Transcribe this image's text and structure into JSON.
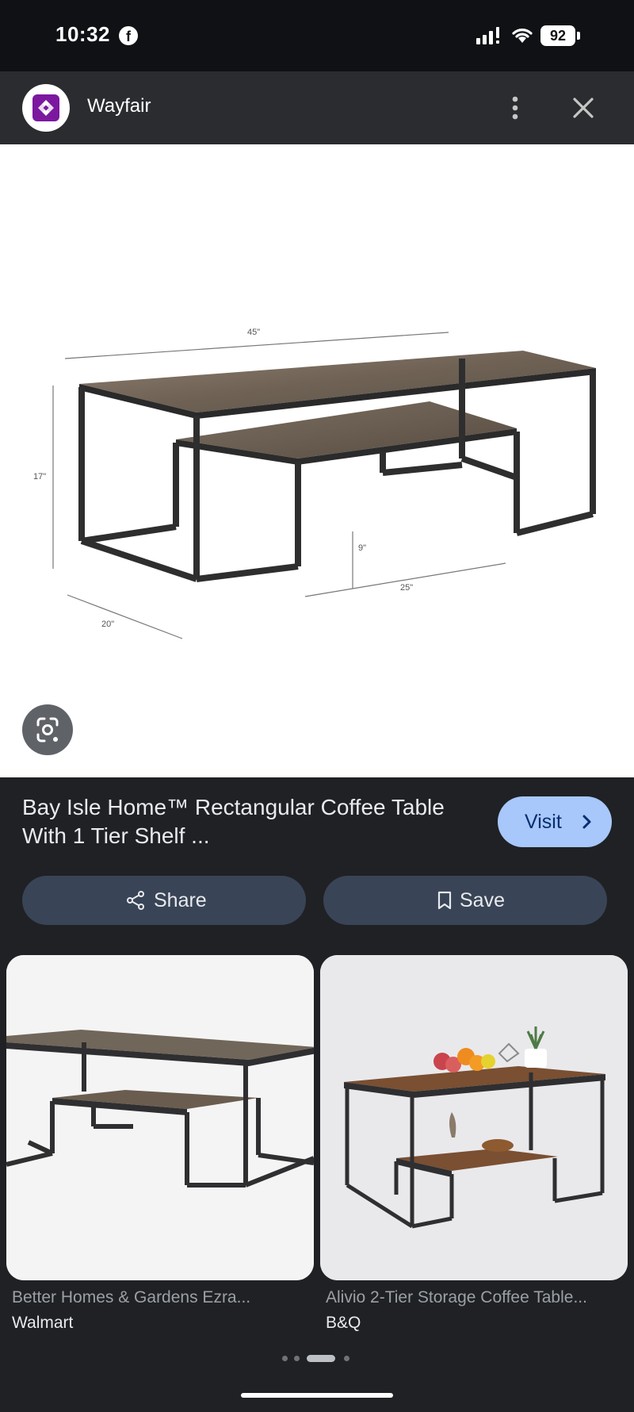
{
  "status_bar": {
    "time": "10:32",
    "battery": "92",
    "app_icon": "facebook-icon"
  },
  "source": {
    "name": "Wayfair",
    "logo_icon": "wayfair-logo"
  },
  "main_image": {
    "dimensions": {
      "width_label": "45\"",
      "height_label": "17\"",
      "depth_label": "20\"",
      "shelf_height_label": "9\"",
      "shelf_width_label": "25\""
    },
    "lens_icon": "lens-icon"
  },
  "product": {
    "title": "Bay Isle Home™ Rectangular Coffee Table With 1 Tier Shelf ...",
    "visit_label": "Visit"
  },
  "actions": {
    "share_label": "Share",
    "save_label": "Save"
  },
  "related": [
    {
      "title": "Better Homes & Gardens Ezra...",
      "source": "Walmart"
    },
    {
      "title": "Alivio 2-Tier Storage Coffee Table...",
      "source": "B&Q"
    }
  ],
  "colors": {
    "background": "#202124",
    "visit_button": "#a8c7fa",
    "action_button": "#394457",
    "wayfair_purple": "#7b189f"
  }
}
